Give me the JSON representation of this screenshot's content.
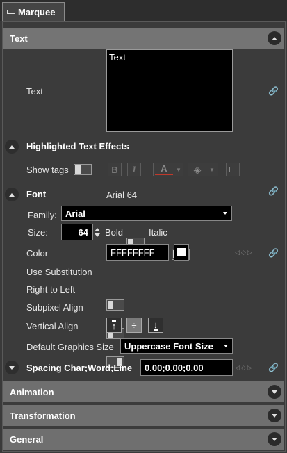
{
  "tab": {
    "label": "Marquee"
  },
  "sections": {
    "text": {
      "title": "Text"
    },
    "animation": {
      "title": "Animation"
    },
    "transformation": {
      "title": "Transformation"
    },
    "general": {
      "title": "General"
    }
  },
  "text_prop": {
    "label": "Text",
    "value": "Text"
  },
  "highlight": {
    "title": "Highlighted Text Effects",
    "show_tags_label": "Show tags",
    "bold_glyph": "B",
    "italic_glyph": "I",
    "font_color_glyph": "A"
  },
  "font": {
    "title": "Font",
    "summary": "Arial 64",
    "family_label": "Family:",
    "family_value": "Arial",
    "size_label": "Size:",
    "size_value": "64",
    "bold_label": "Bold",
    "italic_label": "Italic",
    "color_label": "Color",
    "color_value": "FFFFFFFF",
    "color_swatch": "#ffffff",
    "use_substitution_label": "Use Substitution",
    "rtl_label": "Right to Left",
    "subpixel_label": "Subpixel Align",
    "valign_label": "Vertical Align",
    "default_gfx_label": "Default Graphics Size",
    "default_gfx_value": "Uppercase Font Size"
  },
  "spacing": {
    "label": "Spacing Char;Word;Line",
    "value": "0.00;0.00;0.00"
  },
  "colors": {
    "section_header": "#6f6f6f",
    "panel": "#3b3b3b",
    "accent_red": "#c0392b"
  }
}
